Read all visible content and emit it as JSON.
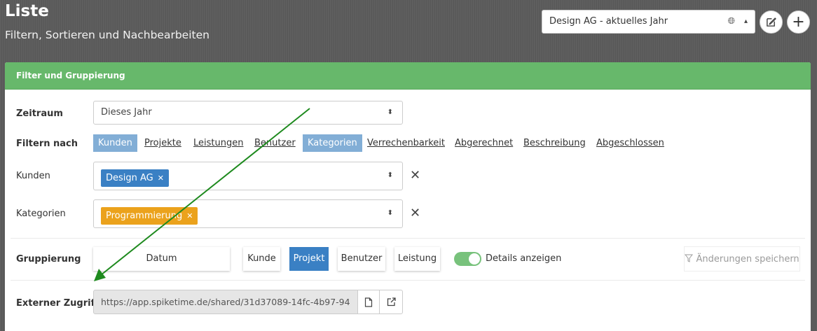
{
  "page": {
    "title": "Liste",
    "subtitle": "Filtern, Sortieren und Nachbearbeiten"
  },
  "header": {
    "workspace_select_value": "Design AG - aktuelles Jahr",
    "globe_icon": "globe-icon",
    "edit_icon": "edit-icon",
    "add_icon": "plus-icon"
  },
  "panel": {
    "title": "Filter und Gruppierung",
    "accent": "#67b86b"
  },
  "zeitraum": {
    "label": "Zeitraum",
    "value": "Dieses Jahr"
  },
  "filter_by": {
    "label": "Filtern nach",
    "items": [
      {
        "label": "Kunden",
        "active": true
      },
      {
        "label": "Projekte",
        "active": false
      },
      {
        "label": "Leistungen",
        "active": false
      },
      {
        "label": "Benutzer",
        "active": false
      },
      {
        "label": "Kategorien",
        "active": true
      },
      {
        "label": "Verrechenbarkeit",
        "active": false
      },
      {
        "label": "Abgerechnet",
        "active": false
      },
      {
        "label": "Beschreibung",
        "active": false
      },
      {
        "label": "Abgeschlossen",
        "active": false
      }
    ]
  },
  "kunden": {
    "label": "Kunden",
    "tags": [
      "Design AG"
    ],
    "tag_color": "#3a80c4"
  },
  "kategorien": {
    "label": "Kategorien",
    "tags": [
      "Programmierung"
    ],
    "tag_color": "#eba21c"
  },
  "gruppierung": {
    "label": "Gruppierung",
    "options": [
      {
        "label": "Datum",
        "active": false
      },
      {
        "label": "Kunde",
        "active": false
      },
      {
        "label": "Projekt",
        "active": true
      },
      {
        "label": "Benutzer",
        "active": false
      },
      {
        "label": "Leistung",
        "active": false
      }
    ],
    "details_label": "Details anzeigen",
    "details_on": true,
    "save_label": "Änderungen speichern"
  },
  "external": {
    "label": "Externer Zugriff",
    "url": "https://app.spiketime.de/shared/31d37089-14fc-4b97-94",
    "copy_icon": "document-icon",
    "open_icon": "external-link-icon"
  }
}
